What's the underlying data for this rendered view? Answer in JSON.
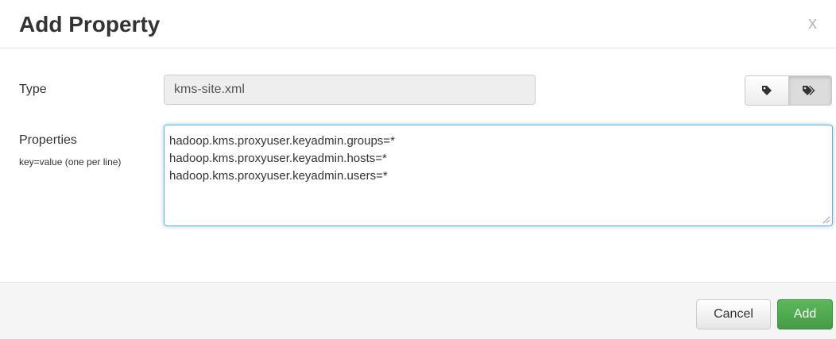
{
  "dialog": {
    "title": "Add Property",
    "close_label": "x"
  },
  "form": {
    "type_label": "Type",
    "type_value": "kms-site.xml",
    "properties_label": "Properties",
    "properties_help": "key=value (one per line)",
    "properties_lines": [
      "hadoop.kms.proxyuser.keyadmin.groups=*",
      "hadoop.kms.proxyuser.keyadmin.hosts=*",
      "hadoop.kms.proxyuser.keyadmin.users=*"
    ],
    "view_toggle": {
      "options": [
        "tag-icon",
        "tags-icon"
      ],
      "selected": "tags-icon"
    }
  },
  "footer": {
    "cancel_label": "Cancel",
    "add_label": "Add"
  },
  "colors": {
    "add_button": "#5cb85c",
    "focus_border": "#66afe9",
    "footer_bg": "#f5f5f5",
    "readonly_bg": "#eeeeee"
  }
}
